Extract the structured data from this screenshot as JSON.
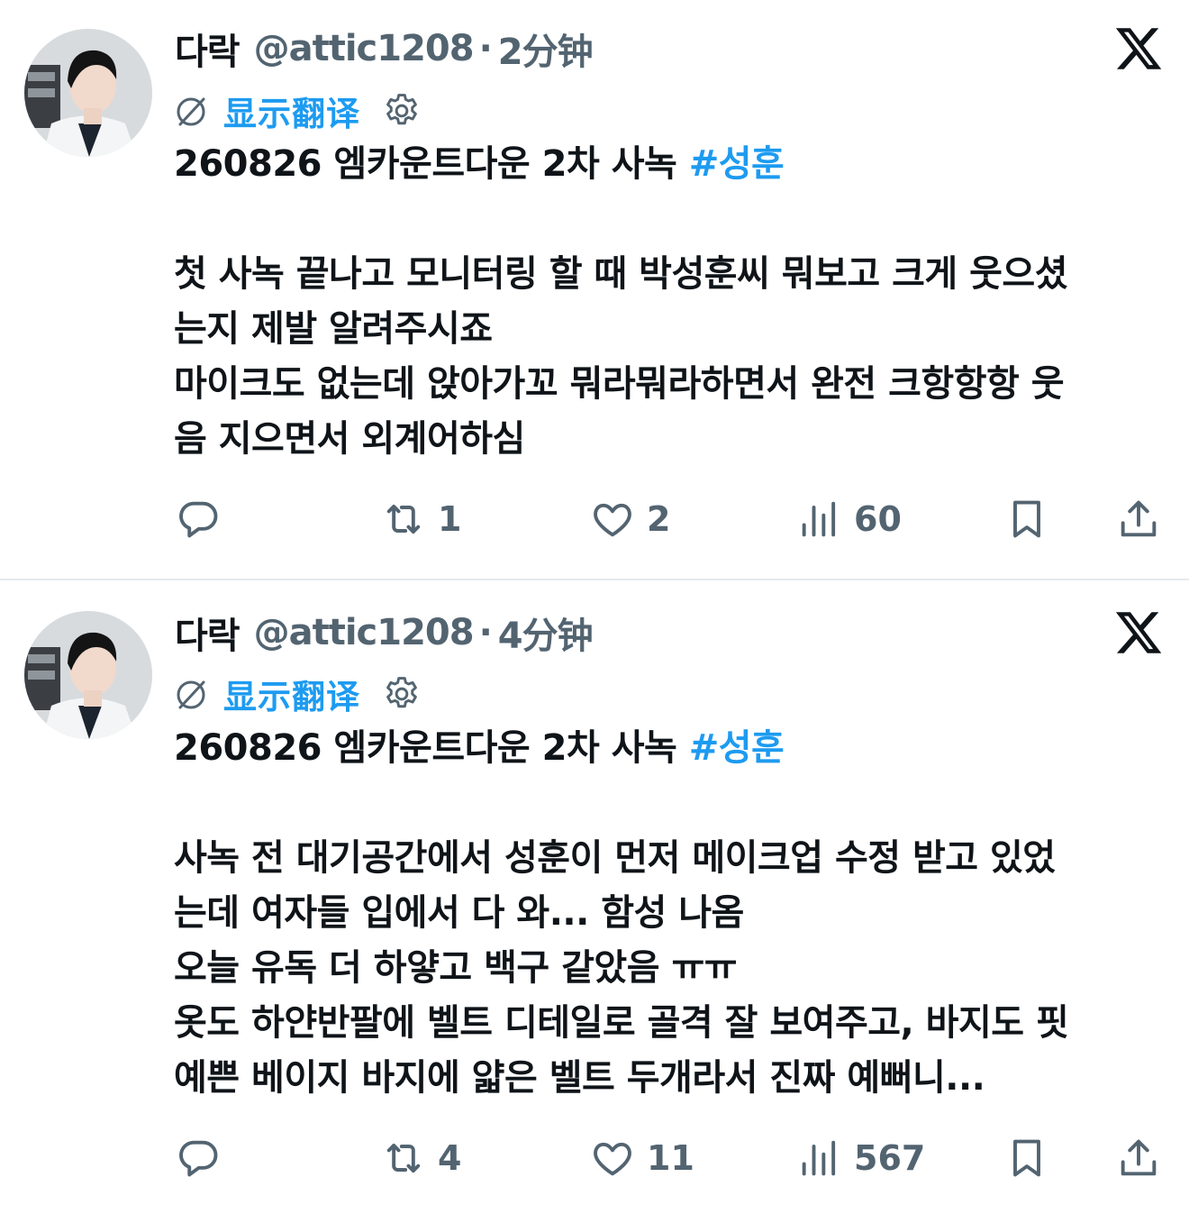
{
  "colors": {
    "accent": "#1d9bf0",
    "text": "#0f1419",
    "muted": "#536471",
    "divider": "#e6e9ec"
  },
  "tweets": [
    {
      "display_name": "다락",
      "handle": "@attic1208",
      "separator": "·",
      "time": "2分钟",
      "translate_label": "显示翻译",
      "title_text": "260826 엠카운트다운 2차 사녹 ",
      "hashtag": "#성훈",
      "lines": [
        "첫 사녹 끝나고 모니터링 할 때 박성훈씨 뭐보고 크게 웃으셨",
        "는지 제발 알려주시죠",
        "마이크도 없는데 앉아가꼬 뭐라뭐라하면서 완전 크항항항 웃",
        "음 지으면서 외계어하심"
      ],
      "reply_count": "",
      "retweet_count": "1",
      "like_count": "2",
      "view_count": "60",
      "icons": [
        "reply-icon",
        "retweet-icon",
        "like-icon",
        "views-icon",
        "bookmark-icon",
        "share-icon"
      ]
    },
    {
      "display_name": "다락",
      "handle": "@attic1208",
      "separator": "·",
      "time": "4分钟",
      "translate_label": "显示翻译",
      "title_text": "260826 엠카운트다운 2차 사녹 ",
      "hashtag": "#성훈",
      "lines": [
        "사녹 전 대기공간에서 성훈이 먼저 메이크업 수정 받고 있었",
        "는데 여자들 입에서 다 와... 함성 나옴",
        "오늘 유독 더 하얗고 백구 같았음 ㅠㅠ",
        "옷도 하얀반팔에 벨트 디테일로 골격 잘 보여주고, 바지도 핏",
        "예쁜 베이지 바지에 얇은 벨트 두개라서 진짜 예뻐니..."
      ],
      "reply_count": "",
      "retweet_count": "4",
      "like_count": "11",
      "view_count": "567",
      "icons": [
        "reply-icon",
        "retweet-icon",
        "like-icon",
        "views-icon",
        "bookmark-icon",
        "share-icon"
      ]
    }
  ]
}
